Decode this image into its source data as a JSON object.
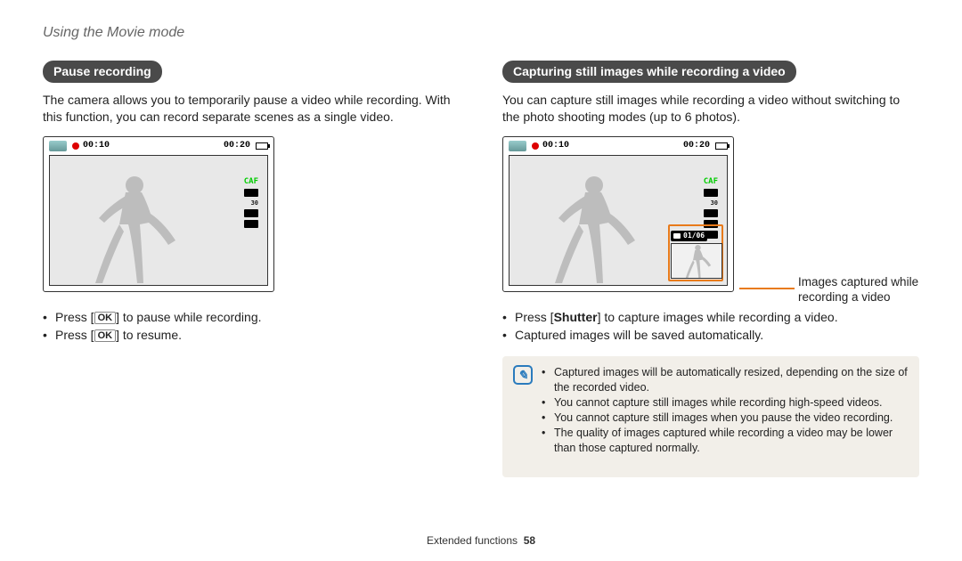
{
  "header": "Using the Movie mode",
  "left": {
    "pill": "Pause recording",
    "para": "The camera allows you to temporarily pause a video while recording. With this function, you can record separate scenes as a single video.",
    "lcd": {
      "time_elapsed": "00:10",
      "time_remain": "00:20",
      "caf": "CAF"
    },
    "bul1_a": "Press [",
    "bul1_ok": "OK",
    "bul1_b": "] to pause while recording.",
    "bul2_a": "Press [",
    "bul2_ok": "OK",
    "bul2_b": "] to resume."
  },
  "right": {
    "pill": "Capturing still images while recording a video",
    "para": "You can capture still images while recording a video without switching to the photo shooting modes (up to 6 photos).",
    "lcd": {
      "time_elapsed": "00:10",
      "time_remain": "00:20",
      "caf": "CAF",
      "thumb_label": "01/06"
    },
    "callout": "Images captured while recording a video",
    "bul1_a": "Press [",
    "bul1_strong": "Shutter",
    "bul1_b": "] to capture images while recording a video.",
    "bul2": "Captured images will be saved automatically.",
    "note": {
      "n1": "Captured images will be automatically resized, depending on the size of the recorded video.",
      "n2": "You cannot capture still images while recording high-speed videos.",
      "n3": "You cannot capture still images when you pause the video recording.",
      "n4": "The quality of images captured while recording a video may be lower than those captured normally."
    }
  },
  "footer": {
    "section": "Extended functions",
    "page": "58"
  }
}
